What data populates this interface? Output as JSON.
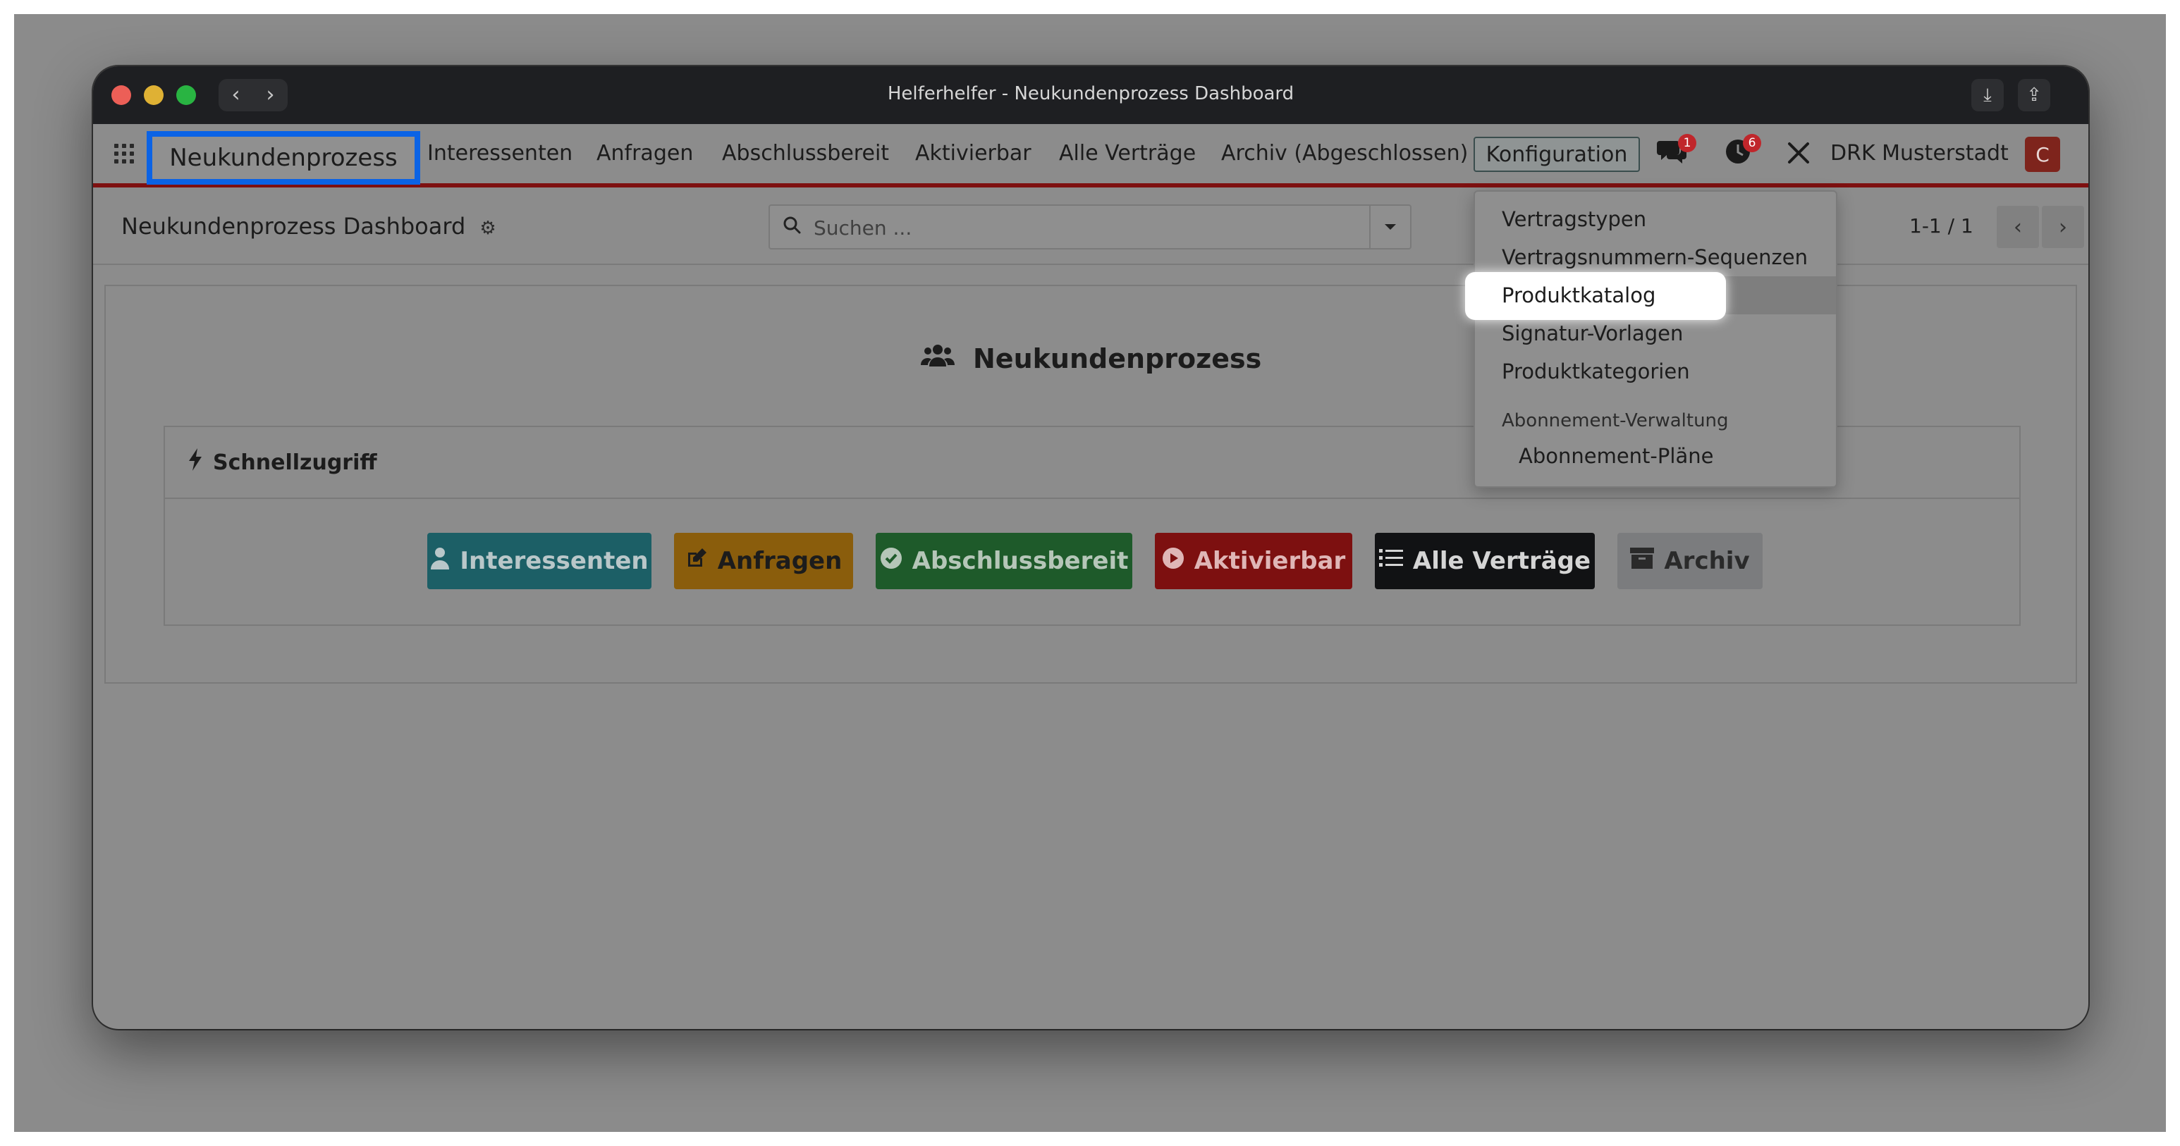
{
  "window": {
    "title": "Helferhelfer - Neukundenprozess Dashboard",
    "nav_back": "‹",
    "nav_forward": "›",
    "download_icon": "⤓",
    "share_icon": "⇪"
  },
  "navbar": {
    "brand": "Neukundenprozess",
    "items": [
      "Interessenten",
      "Anfragen",
      "Abschlussbereit",
      "Aktivierbar",
      "Alle Verträge",
      "Archiv (Abgeschlossen)"
    ],
    "active_menu": "Konfiguration",
    "messages_badge": "1",
    "activities_badge": "6",
    "company": "DRK Musterstadt",
    "avatar_letter": "C"
  },
  "control_panel": {
    "breadcrumb": "Neukundenprozess Dashboard",
    "search_placeholder": "Suchen ...",
    "pager": "1-1 / 1"
  },
  "content": {
    "title": "Neukundenprozess",
    "card_title": "Schnellzugriff",
    "buttons": [
      "Interessenten",
      "Anfragen",
      "Abschlussbereit",
      "Aktivierbar",
      "Alle Verträge",
      "Archiv"
    ]
  },
  "dropdown": {
    "items": [
      "Vertragstypen",
      "Vertragsnummern-Sequenzen",
      "Produktkatalog",
      "Signatur-Vorlagen",
      "Produktkategorien"
    ],
    "section_header": "Abonnement-Verwaltung",
    "section_items": [
      "Abonnement-Pläne"
    ],
    "highlighted_item": "Produktkatalog"
  }
}
